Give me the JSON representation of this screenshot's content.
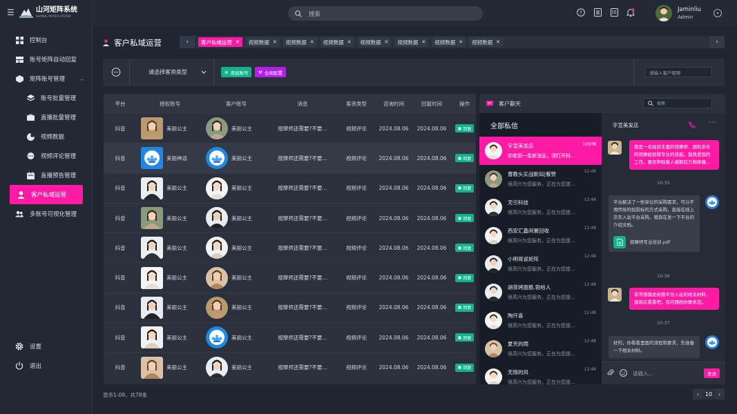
{
  "app": {
    "title": "山河矩阵系统",
    "subtitle": "SHANHE MATRIX SYSTEM"
  },
  "sidebar": {
    "items": [
      {
        "label": "控制台",
        "icon": "grid-icon"
      },
      {
        "label": "账号矩阵自动回复",
        "icon": "matrix-icon"
      },
      {
        "label": "矩阵账号管理",
        "icon": "box-icon"
      },
      {
        "label": "账号批量管理",
        "icon": "layers-icon"
      },
      {
        "label": "直播批量管理",
        "icon": "live-icon"
      },
      {
        "label": "视频数据",
        "icon": "pie-icon"
      },
      {
        "label": "视频评论管理",
        "icon": "comment-icon"
      },
      {
        "label": "直播预告管理",
        "icon": "calendar-icon"
      },
      {
        "label": "客户私域运营",
        "icon": "user-icon"
      },
      {
        "label": "多账号可视化管理",
        "icon": "users-icon"
      }
    ],
    "bottom": [
      {
        "label": "设置",
        "icon": "gear-icon"
      },
      {
        "label": "退出",
        "icon": "power-icon"
      }
    ]
  },
  "header": {
    "search_placeholder": "搜索",
    "user": {
      "name": "Jaminliu",
      "role": "Admin"
    }
  },
  "page": {
    "title": "客户私域运营"
  },
  "tabs": [
    "客户私域运营",
    "视频数据",
    "视频数据",
    "视频数据",
    "视频数据",
    "视频数据",
    "视频数据",
    "视频数据"
  ],
  "filter": {
    "select_label": "请选择客资类型",
    "add_button": "添加账号",
    "config_button": "全局配置",
    "search_placeholder": "请输入客户昵称"
  },
  "table": {
    "headers": [
      "平台",
      "授权账号",
      "客户账号",
      "消息",
      "客资类型",
      "咨询时间",
      "回复时间",
      "操作"
    ],
    "rows": [
      {
        "platform": "抖音",
        "auth": "美丽公主",
        "customer": "美丽公主",
        "message": "按摩师还需要?不要...",
        "type": "视频评论",
        "ask_time": "2024.08.06",
        "reply_time": "2024.08.06",
        "action": "回复"
      },
      {
        "platform": "抖音",
        "auth": "美丽神话",
        "customer": "美丽公主",
        "message": "按摩师还需要?不要...",
        "type": "视频评论",
        "ask_time": "2024.08.06",
        "reply_time": "2024.08.06",
        "action": "回复"
      },
      {
        "platform": "抖音",
        "auth": "美丽公主",
        "customer": "美丽公主",
        "message": "按摩师还需要?不要...",
        "type": "视频评论",
        "ask_time": "2024.08.06",
        "reply_time": "2024.08.06",
        "action": "回复"
      },
      {
        "platform": "抖音",
        "auth": "美丽公主",
        "customer": "美丽公主",
        "message": "按摩师还需要?不要...",
        "type": "视频评论",
        "ask_time": "2024.08.06",
        "reply_time": "2024.08.06",
        "action": "回复"
      },
      {
        "platform": "抖音",
        "auth": "美丽公主",
        "customer": "美丽公主",
        "message": "按摩师还需要?不要...",
        "type": "视频评论",
        "ask_time": "2024.08.06",
        "reply_time": "2024.08.06",
        "action": "回复"
      },
      {
        "platform": "抖音",
        "auth": "美丽公主",
        "customer": "美丽公主",
        "message": "按摩师还需要?不要...",
        "type": "视频评论",
        "ask_time": "2024.08.06",
        "reply_time": "2024.08.06",
        "action": "回复"
      },
      {
        "platform": "抖音",
        "auth": "美丽公主",
        "customer": "美丽公主",
        "message": "按摩师还需要?不要...",
        "type": "视频评论",
        "ask_time": "2024.08.06",
        "reply_time": "2024.08.06",
        "action": "回复"
      },
      {
        "platform": "抖音",
        "auth": "美丽公主",
        "customer": "美丽公主",
        "message": "按摩师还需要?不要...",
        "type": "视频评论",
        "ask_time": "2024.08.06",
        "reply_time": "2024.08.06",
        "action": "回复"
      },
      {
        "platform": "抖音",
        "auth": "美丽公主",
        "customer": "美丽公主",
        "message": "按摩师还需要?不要...",
        "type": "视频评论",
        "ask_time": "2024.08.06",
        "reply_time": "2024.08.06",
        "action": "回复"
      }
    ]
  },
  "pagination": {
    "info": "显示1-09，共78条",
    "current": "10"
  },
  "chat": {
    "title": "客户聊天",
    "search_placeholder": "搜索",
    "list_title": "全部私信",
    "conversations": [
      {
        "name": "宇宣美发店",
        "msg": "你收到一条新消息，请打开抖...",
        "time": "10分钟"
      },
      {
        "name": "曹教头实战新知|餐赞",
        "msg": "很高兴为您服务，正在为您提...",
        "time": "12:48"
      },
      {
        "name": "无引科技",
        "msg": "很高兴为您服务，正在为您提...",
        "time": "12:48"
      },
      {
        "name": "西安汇鑫闲置回收",
        "msg": "很高兴为您服务，正在为您提...",
        "time": "12:48"
      },
      {
        "name": "小明哥说矩阵",
        "msg": "很高兴为您服务，正在为您提...",
        "time": "12:48"
      },
      {
        "name": "胡菲烤面筋.勃哈人",
        "msg": "很高兴为您服务，正在为您提...",
        "time": "12:48"
      },
      {
        "name": "陶仟喜",
        "msg": "很高兴为您服务，正在为您提...",
        "time": "12:48"
      },
      {
        "name": "夏天的雨",
        "msg": "很高兴为您服务，正在为您提...",
        "time": "12:48"
      },
      {
        "name": "无情的风",
        "msg": "很高兴为您服务，正在为您提...",
        "time": "12:48"
      }
    ],
    "window": {
      "title": "宇宣美发店",
      "messages": [
        {
          "dir": "out",
          "text": "我是一名经验丰富的按摩师，拥有多年的按摩经验和专业的技能。我热爱我的工作，喜欢帮助客人缓解压力和疼痛..."
        },
        {
          "dir": "time",
          "text": "10:35"
        },
        {
          "dir": "in",
          "text": "平台解决了一些单位的采购需求，可以不用传统的招投标的方式采购，直接在线上京东入驻平台采购，我现在发一下平台的介绍文档。",
          "file": "按摩师专业培训.pdf"
        },
        {
          "dir": "time",
          "text": "10:36"
        },
        {
          "dir": "out",
          "text": "非常感谢发给我平台入驻的相关材料，我现在看看吧，有问题找你联系您。"
        },
        {
          "dir": "time",
          "text": "10:37"
        },
        {
          "dir": "in",
          "text": "好的，你看看里面的流程和要求，先准备一下相关材料。"
        }
      ],
      "input_placeholder": "请输入...",
      "send_label": "发送"
    }
  },
  "colors": {
    "accent": "#ff1aa5",
    "green": "#13b28c",
    "purple": "#b21ff0",
    "bg": "#1f2632"
  }
}
